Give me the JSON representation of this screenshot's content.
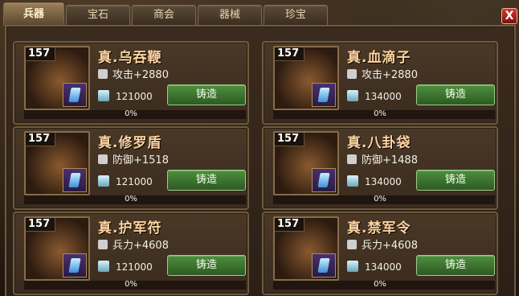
{
  "tabs": [
    {
      "label": "兵器",
      "active": true
    },
    {
      "label": "宝石",
      "active": false
    },
    {
      "label": "商会",
      "active": false
    },
    {
      "label": "器械",
      "active": false
    },
    {
      "label": "珍宝",
      "active": false
    }
  ],
  "close_button": {
    "label": "X"
  },
  "items": [
    {
      "level": "157",
      "name": "真.乌吞鞭",
      "stat_icon": "sword-icon",
      "stat": "攻击+2880",
      "cost": "121000",
      "button": "铸造",
      "progress_text": "0%"
    },
    {
      "level": "157",
      "name": "真.血滴子",
      "stat_icon": "sword-icon",
      "stat": "攻击+2880",
      "cost": "134000",
      "button": "铸造",
      "progress_text": "0%"
    },
    {
      "level": "157",
      "name": "真.修罗盾",
      "stat_icon": "shield-icon",
      "stat": "防御+1518",
      "cost": "121000",
      "button": "铸造",
      "progress_text": "0%"
    },
    {
      "level": "157",
      "name": "真.八卦袋",
      "stat_icon": "shield-icon",
      "stat": "防御+1488",
      "cost": "134000",
      "button": "铸造",
      "progress_text": "0%"
    },
    {
      "level": "157",
      "name": "真.护军符",
      "stat_icon": "soldier-icon",
      "stat": "兵力+4608",
      "cost": "121000",
      "button": "铸造",
      "progress_text": "0%"
    },
    {
      "level": "157",
      "name": "真.禁军令",
      "stat_icon": "soldier-icon",
      "stat": "兵力+4608",
      "cost": "134000",
      "button": "铸造",
      "progress_text": "0%"
    }
  ],
  "colors": {
    "button_green": "#3f7d33",
    "title_peach": "#ffd4a0",
    "frame_brown": "#6e5a3f"
  }
}
